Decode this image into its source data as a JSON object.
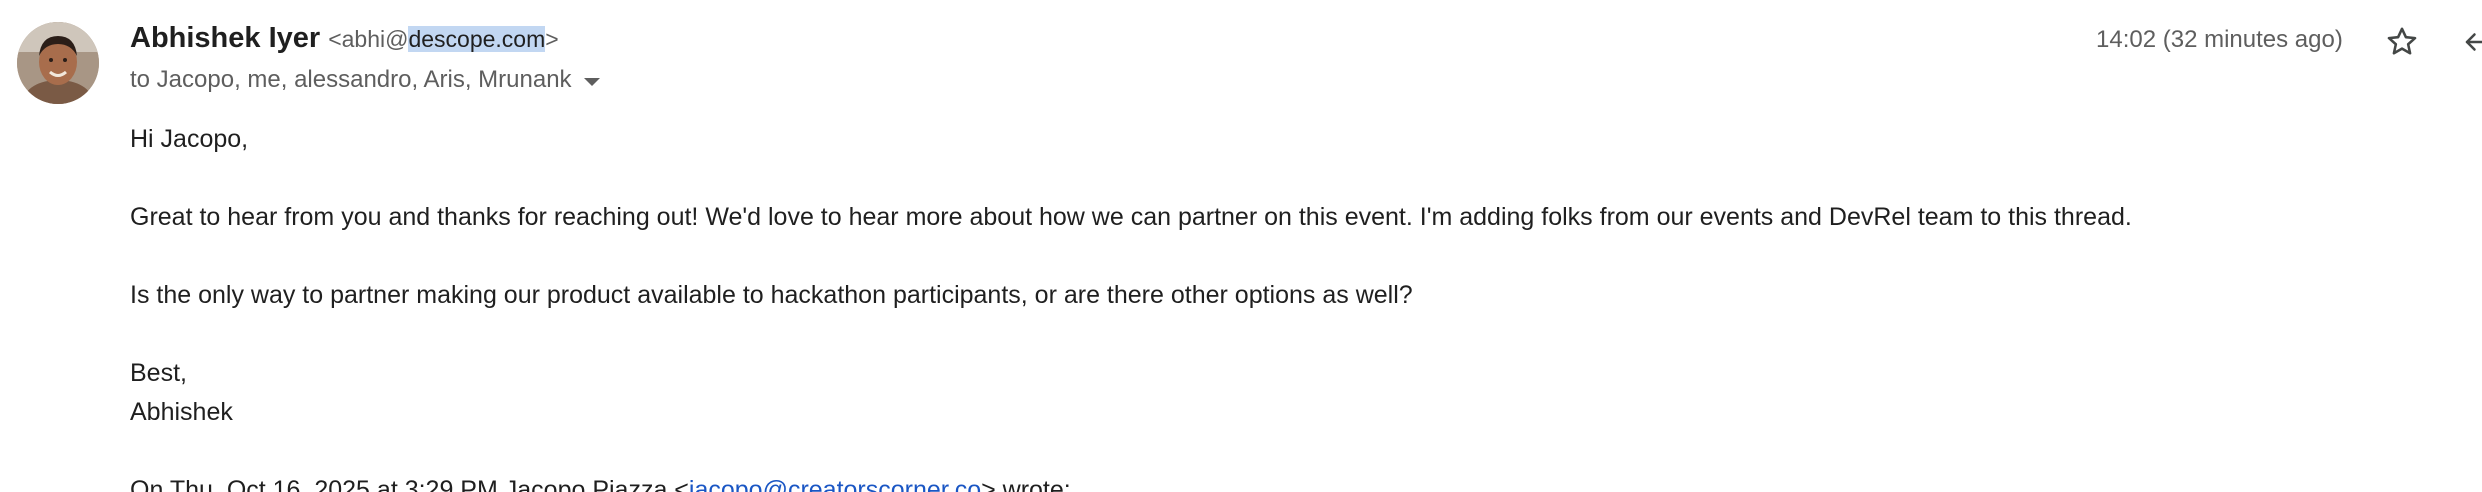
{
  "sender": {
    "name": "Abhishek Iyer",
    "email_open": "<abhi@",
    "email_selected": "descope.com",
    "email_close": ">"
  },
  "recipients": {
    "text": "to Jacopo, me, alessandro, Aris, Mrunank"
  },
  "timestamp": "14:02 (32 minutes ago)",
  "icons": {
    "avatar": "avatar",
    "star": "star-icon",
    "reply": "reply-icon",
    "caret": "chevron-down-icon"
  },
  "body": {
    "greeting": "Hi Jacopo,",
    "paragraph1": "Great to hear from you and thanks for reaching out! We'd love to hear more about how we can partner on this event. I'm adding folks from our events and DevRel team to this thread.",
    "paragraph2": "Is the only way to partner making our product available to hackathon participants, or are there other options as well?",
    "signoff": "Best,",
    "signature": "Abhishek",
    "quote_prefix": "On Thu, Oct 16, 2025 at 3:29 PM Jacopo Piazza <",
    "quote_email": "jacopo@creatorscorner.co",
    "quote_suffix": "> wrote:"
  },
  "colors": {
    "selection": "#c2d7f2",
    "link": "#1a56c4",
    "muted": "#5e5e5e"
  }
}
